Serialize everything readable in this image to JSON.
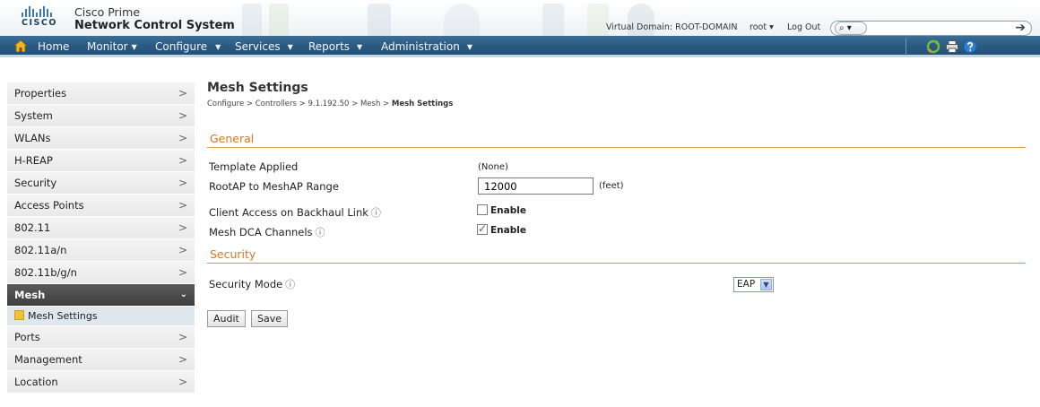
{
  "header": {
    "logo_text": "CISCO",
    "app_subtitle": "Cisco Prime",
    "app_title": "Network Control System",
    "virtual_domain": "Virtual Domain: ROOT-DOMAIN",
    "user": "root ▾",
    "logout": "Log Out",
    "search_scope": "⌕ ▾",
    "search_go": "➔"
  },
  "nav": {
    "home": "Home",
    "items": [
      "Monitor",
      "Configure",
      "Services",
      "Reports",
      "Administration"
    ],
    "caret": "▼"
  },
  "sidebar": {
    "items": [
      {
        "label": "Properties",
        "chev": ">"
      },
      {
        "label": "System",
        "chev": ">"
      },
      {
        "label": "WLANs",
        "chev": ">"
      },
      {
        "label": "H-REAP",
        "chev": ">"
      },
      {
        "label": "Security",
        "chev": ">"
      },
      {
        "label": "Access Points",
        "chev": ">"
      },
      {
        "label": "802.11",
        "chev": ">"
      },
      {
        "label": "802.11a/n",
        "chev": ">"
      },
      {
        "label": "802.11b/g/n",
        "chev": ">"
      },
      {
        "label": "Mesh",
        "chev": "⌄"
      },
      {
        "label": "Ports",
        "chev": ">"
      },
      {
        "label": "Management",
        "chev": ">"
      },
      {
        "label": "Location",
        "chev": ">"
      }
    ],
    "sub_item": "Mesh Settings"
  },
  "main": {
    "title": "Mesh Settings",
    "breadcrumb_prefix": "Configure > Controllers > 9.1.192.50 > Mesh > ",
    "breadcrumb_current": "Mesh Settings",
    "general": {
      "heading": "General",
      "template_label": "Template Applied",
      "template_value": "(None)",
      "range_label": "RootAP to MeshAP Range",
      "range_value": "12000",
      "range_units": "(feet)",
      "client_access_label": "Client Access on Backhaul Link",
      "client_access_text": "Enable",
      "client_access_checked": false,
      "dca_label": "Mesh DCA Channels",
      "dca_text": "Enable",
      "dca_checked": true
    },
    "security": {
      "heading": "Security",
      "mode_label": "Security Mode",
      "mode_value": "EAP"
    },
    "buttons": {
      "audit": "Audit",
      "save": "Save"
    },
    "info_glyph": "ⓘ"
  }
}
